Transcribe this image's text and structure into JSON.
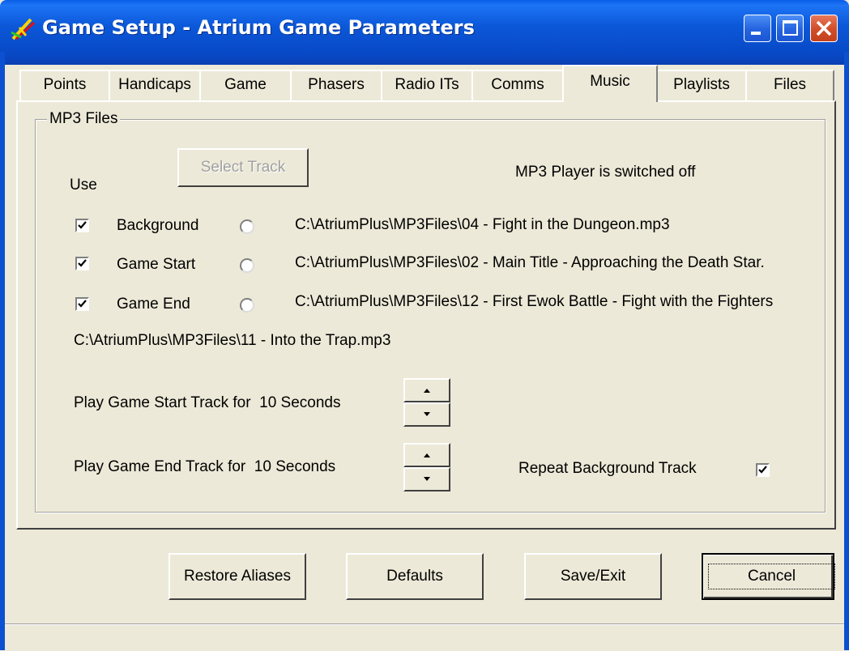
{
  "window": {
    "title": "Game Setup - Atrium Game Parameters",
    "icon": "app-swords-icon"
  },
  "tabs": [
    {
      "label": "Points"
    },
    {
      "label": "Handicaps"
    },
    {
      "label": "Game"
    },
    {
      "label": "Phasers"
    },
    {
      "label": "Radio ITs"
    },
    {
      "label": "Comms"
    },
    {
      "label": "Music",
      "active": true
    },
    {
      "label": "Playlists"
    },
    {
      "label": "Files"
    }
  ],
  "music": {
    "group_title": "MP3 Files",
    "use_label": "Use",
    "select_track_label": "Select Track",
    "player_status": "MP3 Player is switched off",
    "tracks": [
      {
        "label": "Background",
        "checked": true,
        "selected": false,
        "path": "C:\\AtriumPlus\\MP3Files\\04 - Fight in the Dungeon.mp3"
      },
      {
        "label": "Game Start",
        "checked": true,
        "selected": false,
        "path": "C:\\AtriumPlus\\MP3Files\\02 - Main Title - Approaching the Death Star."
      },
      {
        "label": "Game End",
        "checked": true,
        "selected": false,
        "path": "C:\\AtriumPlus\\MP3Files\\12 - First Ewok Battle - Fight with the Fighters"
      }
    ],
    "extra_path": "C:\\AtriumPlus\\MP3Files\\11 - Into the Trap.mp3",
    "start_duration_text": "Play Game Start Track for  10 Seconds",
    "end_duration_text": "Play Game End Track for  10 Seconds",
    "repeat_label": "Repeat Background Track",
    "repeat_checked": true
  },
  "buttons": {
    "restore": "Restore Aliases",
    "defaults": "Defaults",
    "save": "Save/Exit",
    "cancel": "Cancel"
  },
  "colors": {
    "title_bar": "#0a5ee8",
    "face": "#ece9d8",
    "close_button": "#d24f2a"
  }
}
